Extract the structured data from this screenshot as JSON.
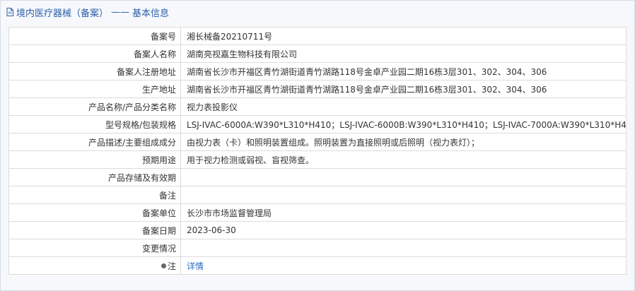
{
  "header": {
    "title": "境内医疗器械（备案）",
    "separator": "——",
    "subtitle": "基本信息"
  },
  "rows": [
    {
      "label": "备案号",
      "value": "湘长械备20210711号"
    },
    {
      "label": "备案人名称",
      "value": "湖南亮视嘉生物科技有限公司"
    },
    {
      "label": "备案人注册地址",
      "value": "湖南省长沙市开福区青竹湖街道青竹湖路118号金卓产业园二期16栋3层301、302、304、306"
    },
    {
      "label": "生产地址",
      "value": "湖南省长沙市开福区青竹湖街道青竹湖路118号金卓产业园二期16栋3层301、302、304、306"
    },
    {
      "label": "产品名称/产品分类名称",
      "value": "视力表投影仪"
    },
    {
      "label": "型号规格/包装规格",
      "value": "LSJ-IVAC-6000A:W390*L310*H410；LSJ-IVAC-6000B:W390*L310*H410；LSJ-IVAC-7000A:W390*L310*H410"
    },
    {
      "label": "产品描述/主要组成成分",
      "value": "由视力表（卡）和照明装置组成。照明装置为直接照明或后照明（视力表灯）；"
    },
    {
      "label": "预期用途",
      "value": "用于视力检测或弱视、盲视筛查。"
    },
    {
      "label": "产品存储及有效期",
      "value": ""
    },
    {
      "label": "备注",
      "value": ""
    },
    {
      "label": "备案单位",
      "value": "长沙市市场监督管理局"
    },
    {
      "label": "备案日期",
      "value": "2023-06-30"
    },
    {
      "label": "变更情况",
      "value": ""
    }
  ],
  "note_row": {
    "label": "注",
    "link_text": "详情"
  }
}
